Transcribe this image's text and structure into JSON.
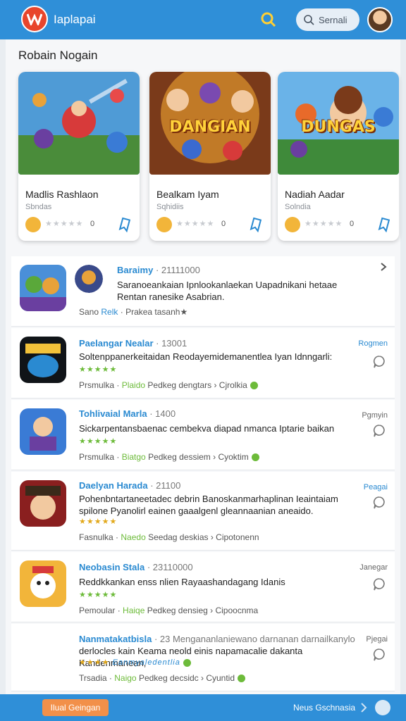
{
  "header": {
    "app_title": "Iaplapai",
    "logo_icon": "brand-logo-icon",
    "search_label": "Sernali",
    "avatar_icon": "user-avatar-icon"
  },
  "featured": {
    "title": "Robain Nogain",
    "cards": [
      {
        "name": "Madlis Rashlaon",
        "subtitle": "Sbndas",
        "art_text": "",
        "rating_count": "0",
        "stars": "★★★★★"
      },
      {
        "name": "Bealkam Iyam",
        "subtitle": "Sqhidiis",
        "art_text": "DANGIAN",
        "rating_count": "0",
        "stars": "★★★★★"
      },
      {
        "name": "Nadiah Aadar",
        "subtitle": "Solndia",
        "art_text": "DUNGAS",
        "rating_count": "0",
        "stars": "★★★★★"
      }
    ]
  },
  "list": [
    {
      "title": "Baraimy",
      "meta": "· 21111000",
      "description": "Saranoeankaian Ipnlookanlaekan Uapadnikani hetaae Rentan ranesike Asabrian.",
      "stars": "",
      "footer_left": "Sano",
      "footer_tag": "Relk",
      "footer_right": "· Prakea tasanh★",
      "side_label": ""
    },
    {
      "title": "Paelangar Nealar",
      "meta": "· 13001",
      "description": "Soltenppanerkeitaidan Reodayemidemanentlea Iyan Idnngarli:",
      "stars": "★★★★★",
      "footer_left": "Prsmulka ·",
      "footer_tag": "Plaido",
      "footer_right": "Pedkeg dengtars › Cjrolkia",
      "side_label": "Rogmen"
    },
    {
      "title": "Tohlivaial Marla",
      "meta": "· 1400",
      "description": "Sickarpentansbaenac cembekva diapad nmanca Iptarie baikan",
      "stars": "★★★★★",
      "footer_left": "Prsmulka ·",
      "footer_tag": "Biatgo",
      "footer_right": "Pedkeg dessiem › Cyoktim",
      "side_label": "Pgmyin"
    },
    {
      "title": "Daelyan Harada",
      "meta": "· 21100",
      "description": "Pohenbntartaneetadec debrin Banoskanmarhaplinan Ieaintaiam spilone Pyanolirl eainen gaaalgenl gleannaanian aneaido.",
      "stars": "★★★★★",
      "footer_left": "Fasnulka ·",
      "footer_tag": "Naedo",
      "footer_right": "Seedag deskias › Cipotonenn",
      "side_label": "Peagai"
    },
    {
      "title": "Neobasin Stala",
      "meta": "· 23110000",
      "description": "Reddkkankan enss nlien Rayaashandagang Idanis",
      "stars": "★★★★★",
      "footer_left": "Pemoular ·",
      "footer_tag": "Haiqe",
      "footer_right": "Pedkeg densieg › Cipoocnma",
      "side_label": "Janegar"
    },
    {
      "title": "Nanmatakatbisla",
      "meta": "· 23 Mengananlaniewano darnanan darnailkanylo",
      "description": "derlocles kain Keama neold einis napamacalie dakanta Kandenmanean,",
      "stars": "★★★★",
      "stars_text": "Eanmyaledentlia",
      "footer_left": "Trsadia ·",
      "footer_tag": "Naigo",
      "footer_right": "Pedkeg decsidc › Cyuntid",
      "side_label": "Pjegai"
    }
  ],
  "bottom_bar": {
    "left_button": "Ilual Geingan",
    "right_link": "Neus Gschnasia"
  },
  "colors": {
    "primary": "#2f8fd8",
    "link": "#2a8ad1",
    "accent_green": "#6dbb3a",
    "accent_orange": "#f2904a"
  }
}
